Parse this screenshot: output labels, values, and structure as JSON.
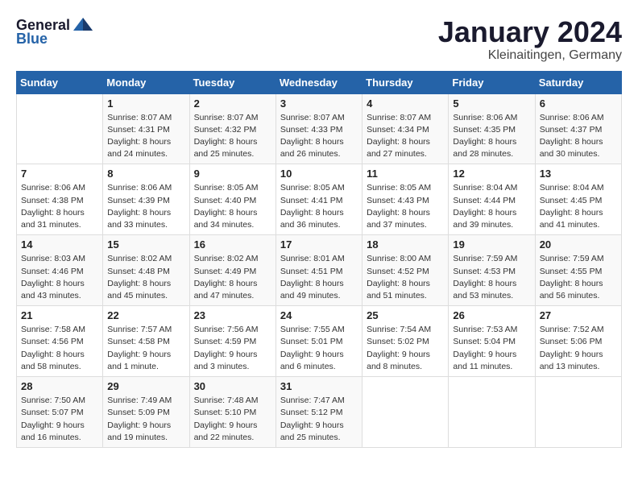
{
  "header": {
    "logo_general": "General",
    "logo_blue": "Blue",
    "month_title": "January 2024",
    "location": "Kleinaitingen, Germany"
  },
  "weekdays": [
    "Sunday",
    "Monday",
    "Tuesday",
    "Wednesday",
    "Thursday",
    "Friday",
    "Saturday"
  ],
  "weeks": [
    [
      {
        "num": "",
        "info": ""
      },
      {
        "num": "1",
        "info": "Sunrise: 8:07 AM\nSunset: 4:31 PM\nDaylight: 8 hours\nand 24 minutes."
      },
      {
        "num": "2",
        "info": "Sunrise: 8:07 AM\nSunset: 4:32 PM\nDaylight: 8 hours\nand 25 minutes."
      },
      {
        "num": "3",
        "info": "Sunrise: 8:07 AM\nSunset: 4:33 PM\nDaylight: 8 hours\nand 26 minutes."
      },
      {
        "num": "4",
        "info": "Sunrise: 8:07 AM\nSunset: 4:34 PM\nDaylight: 8 hours\nand 27 minutes."
      },
      {
        "num": "5",
        "info": "Sunrise: 8:06 AM\nSunset: 4:35 PM\nDaylight: 8 hours\nand 28 minutes."
      },
      {
        "num": "6",
        "info": "Sunrise: 8:06 AM\nSunset: 4:37 PM\nDaylight: 8 hours\nand 30 minutes."
      }
    ],
    [
      {
        "num": "7",
        "info": "Sunrise: 8:06 AM\nSunset: 4:38 PM\nDaylight: 8 hours\nand 31 minutes."
      },
      {
        "num": "8",
        "info": "Sunrise: 8:06 AM\nSunset: 4:39 PM\nDaylight: 8 hours\nand 33 minutes."
      },
      {
        "num": "9",
        "info": "Sunrise: 8:05 AM\nSunset: 4:40 PM\nDaylight: 8 hours\nand 34 minutes."
      },
      {
        "num": "10",
        "info": "Sunrise: 8:05 AM\nSunset: 4:41 PM\nDaylight: 8 hours\nand 36 minutes."
      },
      {
        "num": "11",
        "info": "Sunrise: 8:05 AM\nSunset: 4:43 PM\nDaylight: 8 hours\nand 37 minutes."
      },
      {
        "num": "12",
        "info": "Sunrise: 8:04 AM\nSunset: 4:44 PM\nDaylight: 8 hours\nand 39 minutes."
      },
      {
        "num": "13",
        "info": "Sunrise: 8:04 AM\nSunset: 4:45 PM\nDaylight: 8 hours\nand 41 minutes."
      }
    ],
    [
      {
        "num": "14",
        "info": "Sunrise: 8:03 AM\nSunset: 4:46 PM\nDaylight: 8 hours\nand 43 minutes."
      },
      {
        "num": "15",
        "info": "Sunrise: 8:02 AM\nSunset: 4:48 PM\nDaylight: 8 hours\nand 45 minutes."
      },
      {
        "num": "16",
        "info": "Sunrise: 8:02 AM\nSunset: 4:49 PM\nDaylight: 8 hours\nand 47 minutes."
      },
      {
        "num": "17",
        "info": "Sunrise: 8:01 AM\nSunset: 4:51 PM\nDaylight: 8 hours\nand 49 minutes."
      },
      {
        "num": "18",
        "info": "Sunrise: 8:00 AM\nSunset: 4:52 PM\nDaylight: 8 hours\nand 51 minutes."
      },
      {
        "num": "19",
        "info": "Sunrise: 7:59 AM\nSunset: 4:53 PM\nDaylight: 8 hours\nand 53 minutes."
      },
      {
        "num": "20",
        "info": "Sunrise: 7:59 AM\nSunset: 4:55 PM\nDaylight: 8 hours\nand 56 minutes."
      }
    ],
    [
      {
        "num": "21",
        "info": "Sunrise: 7:58 AM\nSunset: 4:56 PM\nDaylight: 8 hours\nand 58 minutes."
      },
      {
        "num": "22",
        "info": "Sunrise: 7:57 AM\nSunset: 4:58 PM\nDaylight: 9 hours\nand 1 minute."
      },
      {
        "num": "23",
        "info": "Sunrise: 7:56 AM\nSunset: 4:59 PM\nDaylight: 9 hours\nand 3 minutes."
      },
      {
        "num": "24",
        "info": "Sunrise: 7:55 AM\nSunset: 5:01 PM\nDaylight: 9 hours\nand 6 minutes."
      },
      {
        "num": "25",
        "info": "Sunrise: 7:54 AM\nSunset: 5:02 PM\nDaylight: 9 hours\nand 8 minutes."
      },
      {
        "num": "26",
        "info": "Sunrise: 7:53 AM\nSunset: 5:04 PM\nDaylight: 9 hours\nand 11 minutes."
      },
      {
        "num": "27",
        "info": "Sunrise: 7:52 AM\nSunset: 5:06 PM\nDaylight: 9 hours\nand 13 minutes."
      }
    ],
    [
      {
        "num": "28",
        "info": "Sunrise: 7:50 AM\nSunset: 5:07 PM\nDaylight: 9 hours\nand 16 minutes."
      },
      {
        "num": "29",
        "info": "Sunrise: 7:49 AM\nSunset: 5:09 PM\nDaylight: 9 hours\nand 19 minutes."
      },
      {
        "num": "30",
        "info": "Sunrise: 7:48 AM\nSunset: 5:10 PM\nDaylight: 9 hours\nand 22 minutes."
      },
      {
        "num": "31",
        "info": "Sunrise: 7:47 AM\nSunset: 5:12 PM\nDaylight: 9 hours\nand 25 minutes."
      },
      {
        "num": "",
        "info": ""
      },
      {
        "num": "",
        "info": ""
      },
      {
        "num": "",
        "info": ""
      }
    ]
  ]
}
